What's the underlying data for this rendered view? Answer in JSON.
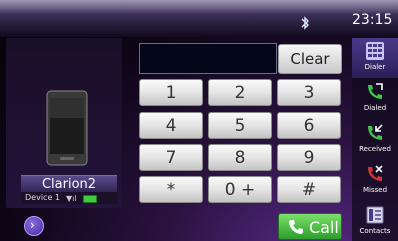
{
  "status": {
    "time": "23:15",
    "bluetooth_icon": "bluetooth-icon"
  },
  "device": {
    "name": "Clarion2",
    "slot": "Device 1",
    "signal_icon": "signal-icon",
    "battery_icon": "battery-icon"
  },
  "dialer": {
    "entry_value": "",
    "clear_label": "Clear",
    "keys": [
      "1",
      "2",
      "3",
      "4",
      "5",
      "6",
      "7",
      "8",
      "9",
      "*",
      "0 +",
      "#"
    ],
    "call_label": "Call"
  },
  "nav": {
    "items": [
      {
        "label": "Dialer",
        "icon": "keypad-icon"
      },
      {
        "label": "Dialed",
        "icon": "dialed-call-icon"
      },
      {
        "label": "Received",
        "icon": "received-call-icon"
      },
      {
        "label": "Missed",
        "icon": "missed-call-icon"
      },
      {
        "label": "Contacts",
        "icon": "contacts-book-icon"
      }
    ]
  },
  "colors": {
    "accent": "#4a3a8a",
    "call_green": "#2c9e2a",
    "background": "#0d0516"
  }
}
